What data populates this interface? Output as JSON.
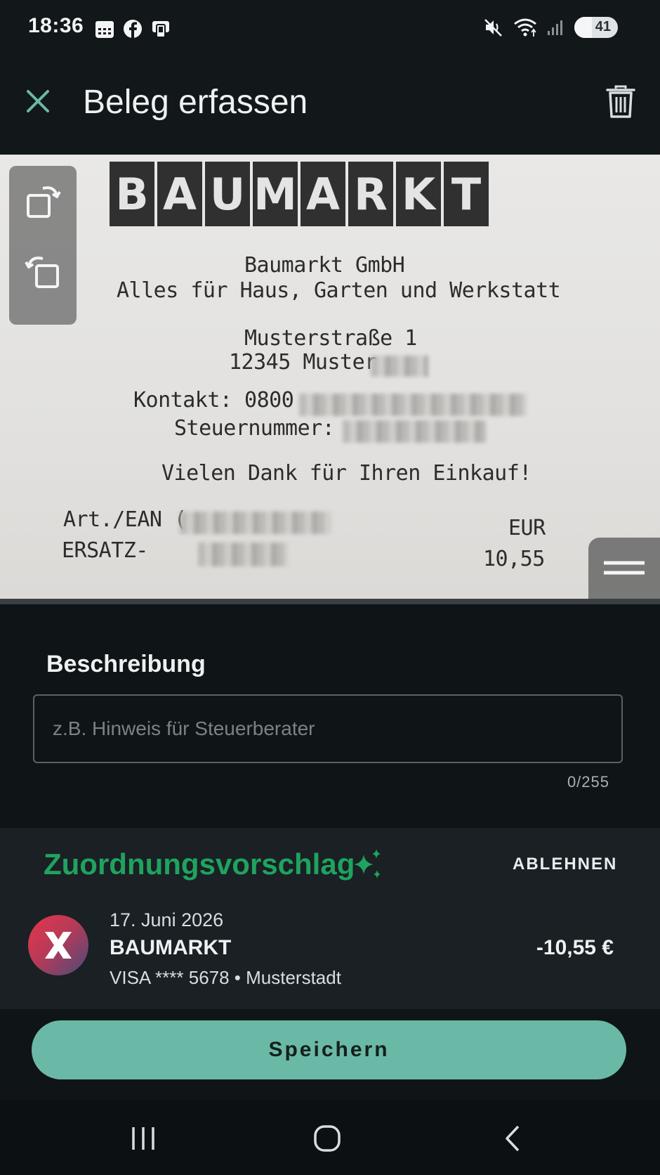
{
  "status_bar": {
    "time": "18:36",
    "left_icons": [
      "calendar-icon",
      "facebook-icon",
      "phone-card-icon"
    ],
    "right_icons": [
      "mute-icon",
      "wifi-icon",
      "signal-icon"
    ],
    "battery_level": "41"
  },
  "header": {
    "title": "Beleg erfassen",
    "close_icon": "close-icon",
    "delete_icon": "trash-icon"
  },
  "receipt": {
    "logo_letters": [
      "B",
      "A",
      "U",
      "M",
      "A",
      "R",
      "K",
      "T"
    ],
    "line_company": "Baumarkt GmbH",
    "line_slogan": "Alles für Haus, Garten und Werkstatt",
    "line_street": "Musterstraße 1",
    "line_city": "12345 Muster",
    "line_contact": "Kontakt: 0800",
    "line_tax": "Steuernummer:",
    "line_thanks": "Vielen Dank für Ihren Einkauf!",
    "line_art": "Art./EAN (",
    "line_currency": "EUR",
    "line_item": "ERSATZ-",
    "line_price": "10,55",
    "tools": [
      "rotate-right-icon",
      "rotate-left-icon",
      "menu-handle-icon"
    ]
  },
  "description": {
    "label": "Beschreibung",
    "placeholder": "z.B. Hinweis für Steuerberater",
    "value": "",
    "counter": "0/255"
  },
  "suggestion": {
    "title": "Zuordnungsvorschlag",
    "reject_label": "ABLEHNEN",
    "date": "17. Juni 2026",
    "merchant": "BAUMARKT",
    "card_info": "VISA **** 5678 • Musterstadt",
    "amount": "-10,55 €",
    "colors": {
      "title": "#1fa35f"
    }
  },
  "actions": {
    "save_label": "Speichern",
    "save_color": "#6ab9a6"
  },
  "nav": {
    "buttons": [
      "recent-apps-icon",
      "home-icon",
      "back-icon"
    ]
  }
}
